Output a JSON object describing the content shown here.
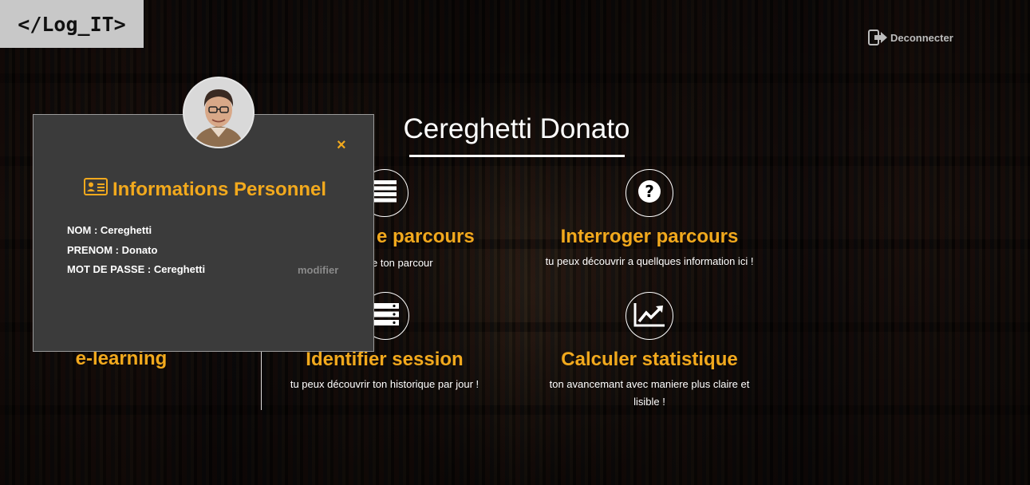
{
  "logo": {
    "text": "</Log_IT>"
  },
  "header": {
    "logout_label": "Deconnecter"
  },
  "main": {
    "user_name": "Cereghetti Donato",
    "features": [
      {
        "title": "e parcours",
        "description": "e ton parcour",
        "icon": "list-icon"
      },
      {
        "title": "Interroger parcours",
        "description": "tu peux découvrir a quellques information ici !",
        "icon": "question-icon"
      },
      {
        "title": "e-learning",
        "description": "",
        "icon": ""
      },
      {
        "title": "Identifier session",
        "description": "tu peux découvrir ton historique par jour !",
        "icon": "server-icon"
      },
      {
        "title": "Calculer statistique",
        "description_line1": "ton avancemant avec maniere plus claire et",
        "description_line2": "lisible !",
        "icon": "chart-icon"
      }
    ]
  },
  "modal": {
    "heading": "Informations Personnel",
    "close_label": "×",
    "nom": "NOM : Cereghetti",
    "prenom": "PRENOM : Donato",
    "mot_de_passe": "MOT DE PASSE : Cereghetti",
    "modify_label": "modifier"
  },
  "colors": {
    "accent": "#f2a91d",
    "modal_bg": "#3b3b3b",
    "logo_bg": "#c8c8c8"
  }
}
